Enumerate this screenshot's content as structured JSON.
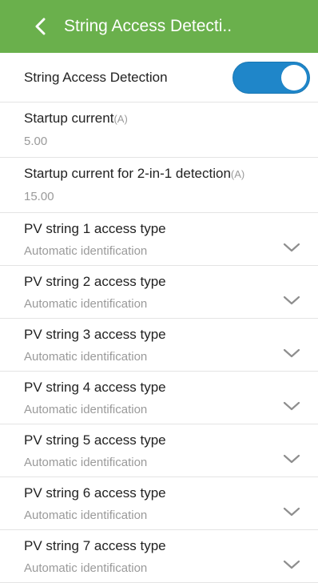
{
  "header": {
    "title": "String Access Detecti.."
  },
  "toggle": {
    "label": "String Access Detection",
    "enabled": true,
    "accent": "#1f86c9"
  },
  "fields": [
    {
      "label": "Startup current",
      "unit": "(A)",
      "value": "5.00"
    },
    {
      "label": "Startup current for 2-in-1 detection",
      "unit": "(A)",
      "value": "15.00"
    }
  ],
  "strings": [
    {
      "label": "PV string 1 access type",
      "value": "Automatic identification"
    },
    {
      "label": "PV string 2 access type",
      "value": "Automatic identification"
    },
    {
      "label": "PV string 3 access type",
      "value": "Automatic identification"
    },
    {
      "label": "PV string 4 access type",
      "value": "Automatic identification"
    },
    {
      "label": "PV string 5 access type",
      "value": "Automatic identification"
    },
    {
      "label": "PV string 6 access type",
      "value": "Automatic identification"
    },
    {
      "label": "PV string 7 access type",
      "value": "Automatic identification"
    }
  ],
  "icons": {
    "back": "chevron-left-icon",
    "dropdown": "chevron-down-icon"
  },
  "colors": {
    "header_bg": "#6ab04c",
    "switch_on": "#1f86c9"
  }
}
